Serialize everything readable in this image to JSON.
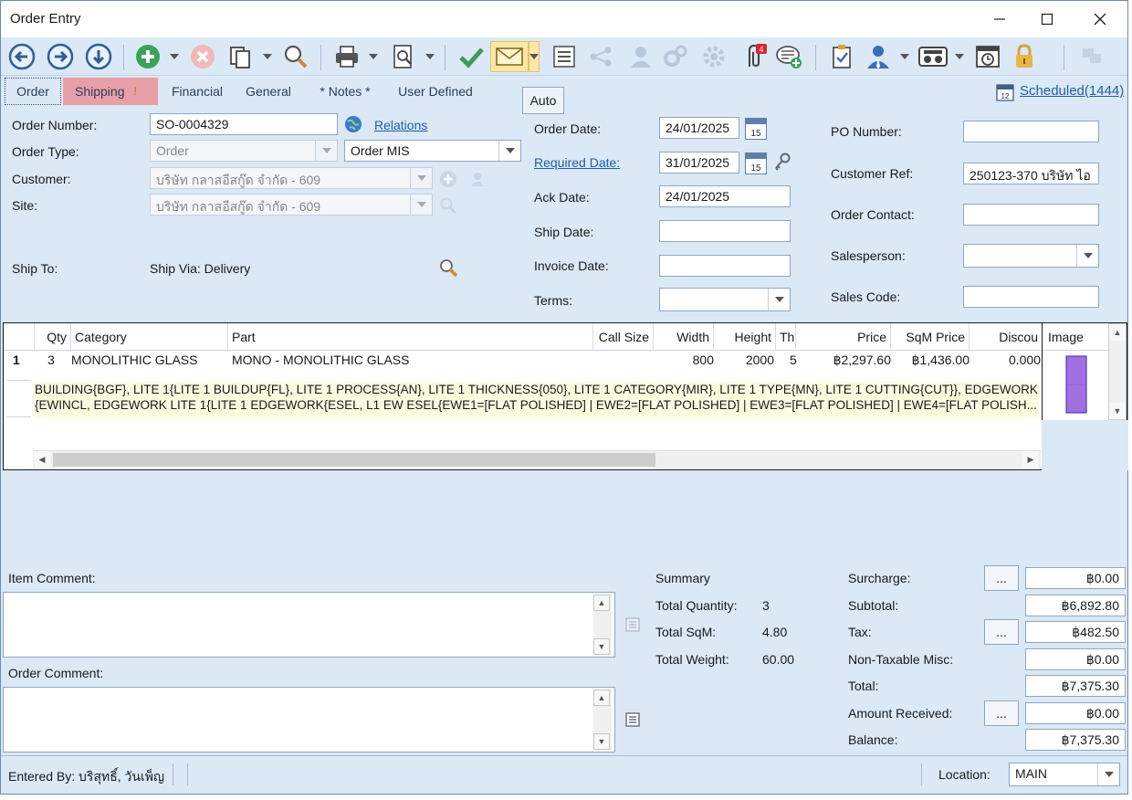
{
  "window": {
    "title": "Order Entry"
  },
  "tabs": {
    "order": "Order",
    "shipping": "Shipping",
    "financial": "Financial",
    "general": "General",
    "notes": "* Notes *",
    "user_defined": "User Defined"
  },
  "auto_button": "Auto",
  "scheduled_link": "Scheduled(1444)",
  "toolbar": {
    "badge_count": "4"
  },
  "form": {
    "order_number_label": "Order Number:",
    "order_number": "SO-0004329",
    "relations_link": "Relations",
    "order_type_label": "Order Type:",
    "order_type": "Order",
    "order_mis": "Order MIS",
    "customer_label": "Customer:",
    "customer": "บริษัท กลาสอีสกู๊ด จำกัด - 609",
    "site_label": "Site:",
    "site": "บริษัท กลาสอีสกู๊ด จำกัด - 609",
    "ship_to_label": "Ship To:",
    "ship_via": "Ship Via: Delivery",
    "order_date_label": "Order Date:",
    "order_date": "24/01/2025",
    "required_date_label": "Required Date:",
    "required_date": "31/01/2025",
    "ack_date_label": "Ack Date:",
    "ack_date": "24/01/2025",
    "ship_date_label": "Ship Date:",
    "ship_date": "",
    "invoice_date_label": "Invoice Date:",
    "invoice_date": "",
    "terms_label": "Terms:",
    "terms": "",
    "calendar_day": "15",
    "po_number_label": "PO Number:",
    "po_number": "",
    "customer_ref_label": "Customer Ref:",
    "customer_ref": "250123-370 บริษัท ไอ",
    "order_contact_label": "Order Contact:",
    "order_contact": "",
    "salesperson_label": "Salesperson:",
    "salesperson": "",
    "sales_code_label": "Sales Code:",
    "sales_code": ""
  },
  "grid": {
    "columns": [
      "Qty",
      "Category",
      "Part",
      "Call Size",
      "Width",
      "Height",
      "Th",
      "Price",
      "SqM Price",
      "Discou",
      "Image"
    ],
    "rows": [
      {
        "line": "1",
        "qty": "3",
        "category": "MONOLITHIC GLASS",
        "part": "MONO - MONOLITHIC GLASS",
        "call_size": "",
        "width": "800",
        "height": "2000",
        "th": "5",
        "price": "฿2,297.60",
        "sqm_price": "฿1,436.00",
        "discount": "0.000",
        "desc_line1": "BUILDING{BGF}, LITE 1{LITE 1 BUILDUP{FL}, LITE 1 PROCESS{AN}, LITE 1 THICKNESS{050}, LITE 1 CATEGORY{MIR}, LITE 1 TYPE{MN}, LITE 1 CUTTING{CUT}}, EDGEWORK",
        "desc_line2": "{EWINCL, EDGEWORK LITE 1{LITE 1 EDGEWORK{ESEL, L1 EW ESEL{EWE1=[FLAT POLISHED] | EWE2=[FLAT POLISHED] | EWE3=[FLAT POLISHED] | EWE4=[FLAT POLISH..."
      }
    ]
  },
  "comments": {
    "item_comment_label": "Item Comment:",
    "order_comment_label": "Order Comment:"
  },
  "summary": {
    "title": "Summary",
    "total_quantity_label": "Total Quantity:",
    "total_quantity": "3",
    "total_sqm_label": "Total SqM:",
    "total_sqm": "4.80",
    "total_weight_label": "Total Weight:",
    "total_weight": "60.00"
  },
  "totals": {
    "surcharge_label": "Surcharge:",
    "surcharge": "฿0.00",
    "subtotal_label": "Subtotal:",
    "subtotal": "฿6,892.80",
    "tax_label": "Tax:",
    "tax": "฿482.50",
    "non_taxable_label": "Non-Taxable Misc:",
    "non_taxable": "฿0.00",
    "total_label": "Total:",
    "total": "฿7,375.30",
    "amount_received_label": "Amount Received:",
    "amount_received": "฿0.00",
    "balance_label": "Balance:",
    "balance": "฿7,375.30",
    "dots": "..."
  },
  "status": {
    "entered_by": "Entered By: บริสุทธิ์, วันเพ็ญ",
    "location_label": "Location:",
    "location": "MAIN"
  }
}
